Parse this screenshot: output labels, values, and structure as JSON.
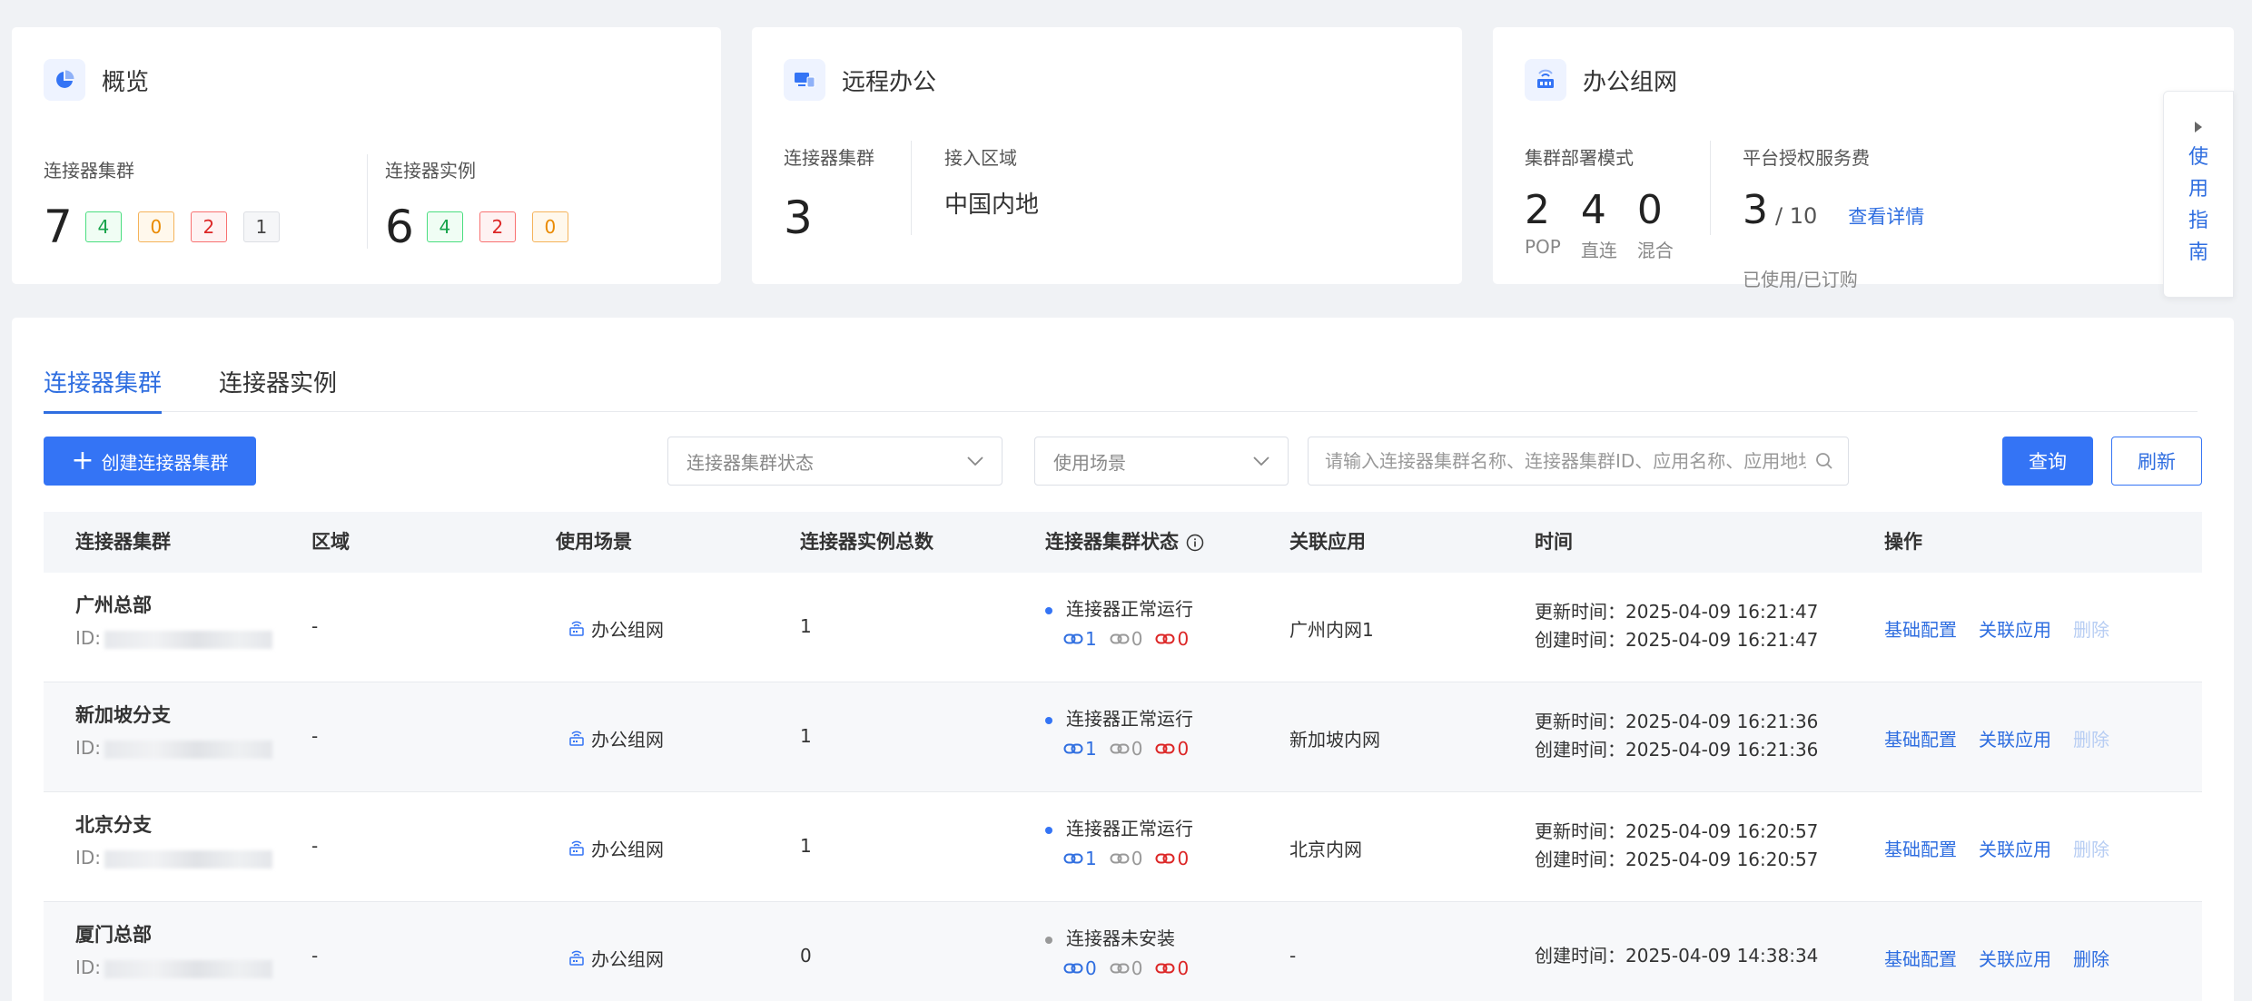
{
  "overview": {
    "title": "概览",
    "cluster_label": "连接器集群",
    "cluster_total": "7",
    "cluster_badges": [
      "4",
      "0",
      "2",
      "1"
    ],
    "instance_label": "连接器实例",
    "instance_total": "6",
    "instance_badges": [
      "4",
      "2",
      "0"
    ]
  },
  "remote": {
    "title": "远程办公",
    "cluster_label": "连接器集群",
    "cluster_value": "3",
    "region_label": "接入区域",
    "region_value": "中国内地"
  },
  "office": {
    "title": "办公组网",
    "mode_label": "集群部署模式",
    "modes": [
      {
        "value": "2",
        "label": "POP"
      },
      {
        "value": "4",
        "label": "直连"
      },
      {
        "value": "0",
        "label": "混合"
      }
    ],
    "fee_label": "平台授权服务费",
    "fee_used": "3",
    "fee_total": "/ 10",
    "fee_link": "查看详情",
    "fee_sub": "已使用/已订购"
  },
  "guide": {
    "label": "使用指南"
  },
  "tabs": [
    "连接器集群",
    "连接器实例"
  ],
  "toolbar": {
    "create_label": "创建连接器集群",
    "status_placeholder": "连接器集群状态",
    "scene_placeholder": "使用场景",
    "search_placeholder": "请输入连接器集群名称、连接器集群ID、应用名称、应用地址进行搜索",
    "query_label": "查询",
    "refresh_label": "刷新"
  },
  "table": {
    "headers": [
      "连接器集群",
      "区域",
      "使用场景",
      "连接器实例总数",
      "连接器集群状态",
      "关联应用",
      "时间",
      "操作"
    ],
    "rows": [
      {
        "name": "广州总部",
        "id_prefix": "ID:",
        "region": "-",
        "scene": "办公组网",
        "instances": "1",
        "status": "连接器正常运行",
        "c1": "1",
        "c2": "0",
        "c3": "0",
        "app": "广州内网1",
        "updated": "更新时间：2025-04-09 16:21:47",
        "created": "创建时间：2025-04-09 16:21:47",
        "op1": "基础配置",
        "op2": "关联应用",
        "op3": "删除",
        "op3_disabled": true
      },
      {
        "name": "新加坡分支",
        "id_prefix": "ID:",
        "region": "-",
        "scene": "办公组网",
        "instances": "1",
        "status": "连接器正常运行",
        "c1": "1",
        "c2": "0",
        "c3": "0",
        "app": "新加坡内网",
        "updated": "更新时间：2025-04-09 16:21:36",
        "created": "创建时间：2025-04-09 16:21:36",
        "op1": "基础配置",
        "op2": "关联应用",
        "op3": "删除",
        "op3_disabled": true
      },
      {
        "name": "北京分支",
        "id_prefix": "ID:",
        "region": "-",
        "scene": "办公组网",
        "instances": "1",
        "status": "连接器正常运行",
        "c1": "1",
        "c2": "0",
        "c3": "0",
        "app": "北京内网",
        "updated": "更新时间：2025-04-09 16:20:57",
        "created": "创建时间：2025-04-09 16:20:57",
        "op1": "基础配置",
        "op2": "关联应用",
        "op3": "删除",
        "op3_disabled": true
      },
      {
        "name": "厦门总部",
        "id_prefix": "ID:",
        "region": "-",
        "scene": "办公组网",
        "instances": "0",
        "status": "连接器未安装",
        "c1": "0",
        "c2": "0",
        "c3": "0",
        "app": "-",
        "updated": "",
        "created": "创建时间：2025-04-09 14:38:34",
        "op1": "基础配置",
        "op2": "关联应用",
        "op3": "删除",
        "op3_disabled": false
      }
    ]
  },
  "colors": {
    "primary": "#3474f5",
    "link": "#2f6ee0",
    "success": "#16a34a",
    "warning": "#ea8a00",
    "danger": "#dc2626"
  }
}
